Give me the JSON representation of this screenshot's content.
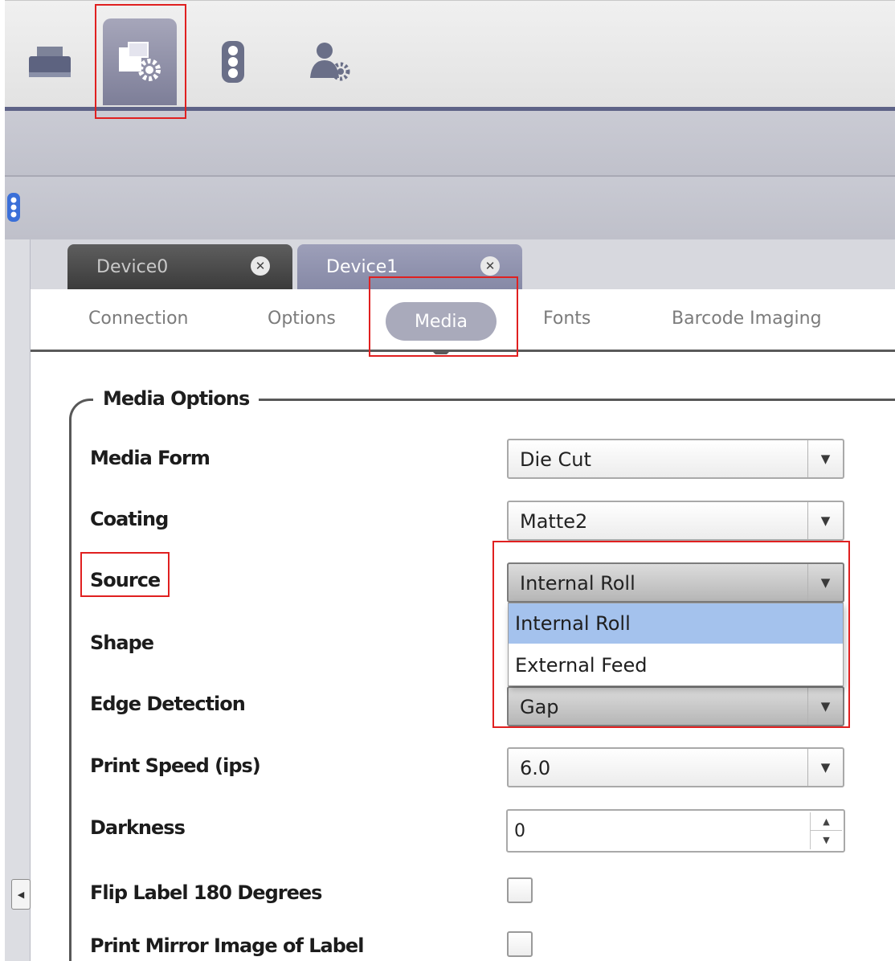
{
  "toolbar": {
    "buttons": [
      {
        "icon": "printer-icon"
      },
      {
        "icon": "device-settings-icon",
        "active": true
      },
      {
        "icon": "traffic-light-icon"
      },
      {
        "icon": "user-settings-icon"
      }
    ]
  },
  "device_tabs": [
    {
      "label": "Device0",
      "active": false
    },
    {
      "label": "Device1",
      "active": true
    }
  ],
  "sub_tabs": [
    {
      "label": "Connection"
    },
    {
      "label": "Options"
    },
    {
      "label": "Media",
      "active": true
    },
    {
      "label": "Fonts"
    },
    {
      "label": "Barcode Imaging"
    }
  ],
  "media_options": {
    "title": "Media Options",
    "media_form": {
      "label": "Media Form",
      "value": "Die Cut"
    },
    "coating": {
      "label": "Coating",
      "value": "Matte2"
    },
    "source": {
      "label": "Source",
      "value": "Internal Roll",
      "options": [
        "Internal Roll",
        "External Feed"
      ],
      "highlighted_option": "Internal Roll"
    },
    "shape": {
      "label": "Shape"
    },
    "edge_detection": {
      "label": "Edge Detection",
      "value": "Gap"
    },
    "print_speed": {
      "label": "Print Speed (ips)",
      "value": "6.0"
    },
    "darkness": {
      "label": "Darkness",
      "value": "0"
    },
    "flip_label": {
      "label": "Flip Label 180 Degrees",
      "checked": false
    },
    "print_mirror": {
      "label": "Print Mirror Image of Label",
      "checked": false
    }
  },
  "colors": {
    "highlight_annotation": "#e02020",
    "active_tab": "#8689a6",
    "selected_option": "#a4c2ed"
  }
}
